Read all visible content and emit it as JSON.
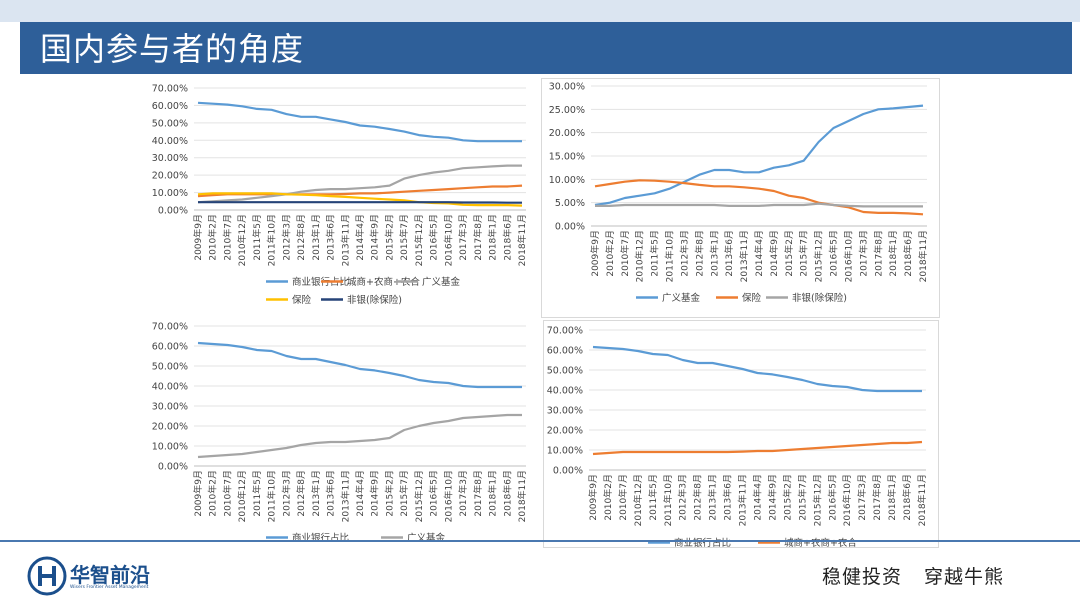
{
  "header": {
    "title": "国内参与者的角度"
  },
  "footer": {
    "logo_name": "华智前沿",
    "logo_sub": "Wisers Frontier Asset Management",
    "slogan_1": "稳健投资",
    "slogan_2": "穿越牛熊"
  },
  "x_tick_labels": [
    "2009年9月",
    "2010年2月",
    "2010年7月",
    "2010年12月",
    "2011年5月",
    "2011年10月",
    "2012年3月",
    "2012年8月",
    "2013年1月",
    "2013年6月",
    "2013年11月",
    "2014年4月",
    "2014年9月",
    "2015年2月",
    "2015年7月",
    "2015年12月",
    "2016年5月",
    "2016年10月",
    "2017年3月",
    "2017年8月",
    "2018年1月",
    "2018年6月",
    "2018年11月"
  ],
  "chart_data": [
    {
      "type": "line",
      "x": [
        "2009年9月",
        "2010年2月",
        "2010年7月",
        "2010年12月",
        "2011年5月",
        "2011年10月",
        "2012年3月",
        "2012年8月",
        "2013年1月",
        "2013年6月",
        "2013年11月",
        "2014年4月",
        "2014年9月",
        "2015年2月",
        "2015年7月",
        "2015年12月",
        "2016年5月",
        "2016年10月",
        "2017年3月",
        "2017年8月",
        "2018年1月",
        "2018年6月",
        "2018年11月"
      ],
      "y_ticks": [
        "0.00%",
        "10.00%",
        "20.00%",
        "30.00%",
        "40.00%",
        "50.00%",
        "60.00%",
        "70.00%"
      ],
      "ylim": [
        0,
        70
      ],
      "legend_position": "bottom",
      "series": [
        {
          "name": "商业银行占比",
          "color": "#5b9bd5",
          "values": [
            61.5,
            61,
            60.5,
            59.5,
            58,
            57.5,
            55,
            53.5,
            53.5,
            52,
            50.5,
            48.5,
            47.8,
            46.5,
            45,
            43,
            42,
            41.5,
            40,
            39.5,
            39.5,
            39.5,
            39.5
          ]
        },
        {
          "name": "城商+农商+农合",
          "color": "#ed7d31",
          "values": [
            8,
            8.5,
            9,
            9,
            9,
            9,
            9,
            9,
            9,
            9,
            9.2,
            9.5,
            9.5,
            10,
            10.5,
            11,
            11.5,
            12,
            12.5,
            13,
            13.5,
            13.5,
            14
          ]
        },
        {
          "name": "广义基金",
          "color": "#a5a5a5",
          "values": [
            4.5,
            5,
            5.5,
            6,
            7,
            8,
            9,
            10.5,
            11.5,
            12,
            12,
            12.5,
            13,
            14,
            18,
            20,
            21.5,
            22.5,
            24,
            24.5,
            25,
            25.5,
            25.5
          ]
        },
        {
          "name": "保险",
          "color": "#ffc000",
          "values": [
            9,
            9.5,
            9.5,
            9.5,
            9.5,
            9.5,
            9,
            8.8,
            8.5,
            8,
            7.5,
            7,
            6.5,
            6,
            5.5,
            4.5,
            4,
            3.8,
            3,
            2.8,
            2.8,
            2.8,
            2.5
          ]
        },
        {
          "name": "非银(除保险)",
          "color": "#264478",
          "values": [
            4.5,
            4.5,
            4.5,
            4.5,
            4.5,
            4.5,
            4.5,
            4.5,
            4.5,
            4.5,
            4.5,
            4.5,
            4.5,
            4.5,
            4.5,
            4.5,
            4.5,
            4.5,
            4.3,
            4.3,
            4.3,
            4.2,
            4.2
          ]
        }
      ]
    },
    {
      "type": "line",
      "x": [
        "2009年9月",
        "2010年2月",
        "2010年7月",
        "2010年12月",
        "2011年5月",
        "2011年10月",
        "2012年3月",
        "2012年8月",
        "2013年1月",
        "2013年6月",
        "2013年11月",
        "2014年4月",
        "2014年9月",
        "2015年2月",
        "2015年7月",
        "2015年12月",
        "2016年5月",
        "2016年10月",
        "2017年3月",
        "2017年8月",
        "2018年1月",
        "2018年6月",
        "2018年11月"
      ],
      "y_ticks": [
        "0.00%",
        "5.00%",
        "10.00%",
        "15.00%",
        "20.00%",
        "25.00%",
        "30.00%"
      ],
      "ylim": [
        0,
        30
      ],
      "legend_position": "bottom",
      "series": [
        {
          "name": "广义基金",
          "color": "#5b9bd5",
          "values": [
            4.5,
            5,
            6,
            6.5,
            7,
            8,
            9.5,
            11,
            12,
            12,
            11.5,
            11.5,
            12.5,
            13,
            14,
            18,
            21,
            22.5,
            24,
            25,
            25.2,
            25.5,
            25.8
          ]
        },
        {
          "name": "保险",
          "color": "#ed7d31",
          "values": [
            8.5,
            9,
            9.5,
            9.8,
            9.7,
            9.5,
            9.2,
            8.8,
            8.5,
            8.5,
            8.3,
            8,
            7.5,
            6.5,
            6,
            5,
            4.5,
            4,
            3,
            2.8,
            2.8,
            2.7,
            2.5
          ]
        },
        {
          "name": "非银(除保险)",
          "color": "#a5a5a5",
          "values": [
            4.3,
            4.3,
            4.5,
            4.5,
            4.5,
            4.5,
            4.5,
            4.5,
            4.5,
            4.3,
            4.3,
            4.3,
            4.5,
            4.5,
            4.5,
            4.8,
            4.5,
            4.3,
            4.2,
            4.2,
            4.2,
            4.2,
            4.2
          ]
        }
      ]
    },
    {
      "type": "line",
      "x": [
        "2009年9月",
        "2010年2月",
        "2010年7月",
        "2010年12月",
        "2011年5月",
        "2011年10月",
        "2012年3月",
        "2012年8月",
        "2013年1月",
        "2013年6月",
        "2013年11月",
        "2014年4月",
        "2014年9月",
        "2015年2月",
        "2015年7月",
        "2015年12月",
        "2016年5月",
        "2016年10月",
        "2017年3月",
        "2017年8月",
        "2018年1月",
        "2018年6月",
        "2018年11月"
      ],
      "y_ticks": [
        "0.00%",
        "10.00%",
        "20.00%",
        "30.00%",
        "40.00%",
        "50.00%",
        "60.00%",
        "70.00%"
      ],
      "ylim": [
        0,
        70
      ],
      "legend_position": "bottom",
      "series": [
        {
          "name": "商业银行占比",
          "color": "#5b9bd5",
          "values": [
            61.5,
            61,
            60.5,
            59.5,
            58,
            57.5,
            55,
            53.5,
            53.5,
            52,
            50.5,
            48.5,
            47.8,
            46.5,
            45,
            43,
            42,
            41.5,
            40,
            39.5,
            39.5,
            39.5,
            39.5
          ]
        },
        {
          "name": "广义基金",
          "color": "#a5a5a5",
          "values": [
            4.5,
            5,
            5.5,
            6,
            7,
            8,
            9,
            10.5,
            11.5,
            12,
            12,
            12.5,
            13,
            14,
            18,
            20,
            21.5,
            22.5,
            24,
            24.5,
            25,
            25.5,
            25.5
          ]
        }
      ]
    },
    {
      "type": "line",
      "x": [
        "2009年9月",
        "2010年2月",
        "2010年7月",
        "2010年12月",
        "2011年5月",
        "2011年10月",
        "2012年3月",
        "2012年8月",
        "2013年1月",
        "2013年6月",
        "2013年11月",
        "2014年4月",
        "2014年9月",
        "2015年2月",
        "2015年7月",
        "2015年12月",
        "2016年5月",
        "2016年10月",
        "2017年3月",
        "2017年8月",
        "2018年1月",
        "2018年6月",
        "2018年11月"
      ],
      "y_ticks": [
        "0.00%",
        "10.00%",
        "20.00%",
        "30.00%",
        "40.00%",
        "50.00%",
        "60.00%",
        "70.00%"
      ],
      "ylim": [
        0,
        70
      ],
      "legend_position": "bottom",
      "series": [
        {
          "name": "商业银行占比",
          "color": "#5b9bd5",
          "values": [
            61.5,
            61,
            60.5,
            59.5,
            58,
            57.5,
            55,
            53.5,
            53.5,
            52,
            50.5,
            48.5,
            47.8,
            46.5,
            45,
            43,
            42,
            41.5,
            40,
            39.5,
            39.5,
            39.5,
            39.5
          ]
        },
        {
          "name": "城商+农商+农合",
          "color": "#ed7d31",
          "values": [
            8,
            8.5,
            9,
            9,
            9,
            9,
            9,
            9,
            9,
            9,
            9.2,
            9.5,
            9.5,
            10,
            10.5,
            11,
            11.5,
            12,
            12.5,
            13,
            13.5,
            13.5,
            14
          ]
        }
      ]
    }
  ]
}
